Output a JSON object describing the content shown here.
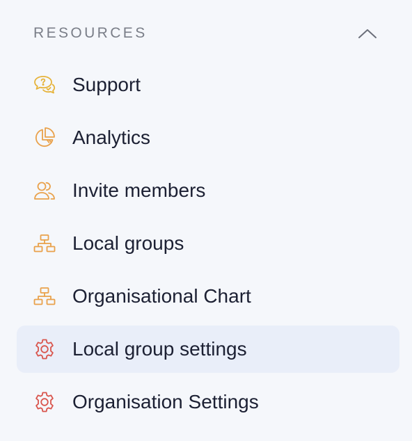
{
  "section": {
    "title": "RESOURCES",
    "toggle_icon": "chevron-up-icon"
  },
  "colors": {
    "background": "#f5f7fb",
    "active_background": "#e9eef9",
    "text": "#1c2033",
    "section_title": "#7a7e88",
    "icon_yellow": "#e6b33a",
    "icon_orange": "#e9a14b",
    "icon_red": "#d9544c"
  },
  "nav": {
    "items": [
      {
        "label": "Support",
        "icon": "chat-bubbles-icon",
        "active": false
      },
      {
        "label": "Analytics",
        "icon": "pie-chart-icon",
        "active": false
      },
      {
        "label": "Invite members",
        "icon": "users-icon",
        "active": false
      },
      {
        "label": "Local groups",
        "icon": "hierarchy-icon",
        "active": false
      },
      {
        "label": "Organisational Chart",
        "icon": "hierarchy-icon",
        "active": false
      },
      {
        "label": "Local group settings",
        "icon": "gear-icon",
        "active": true
      },
      {
        "label": "Organisation Settings",
        "icon": "gear-icon",
        "active": false
      }
    ]
  }
}
